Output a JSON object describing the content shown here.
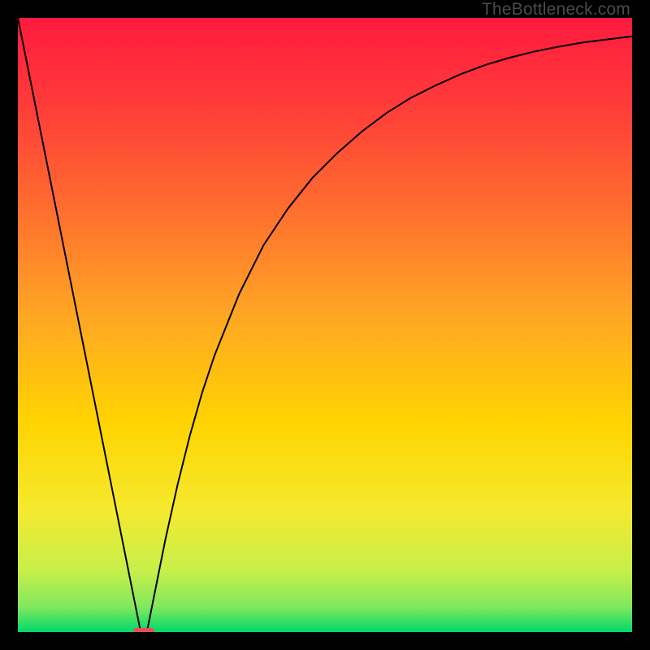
{
  "watermark": "TheBottleneck.com",
  "chart_data": {
    "type": "line",
    "title": "",
    "xlabel": "",
    "ylabel": "",
    "xlim": [
      0,
      100
    ],
    "ylim": [
      0,
      100
    ],
    "grid": false,
    "legend": false,
    "background_gradient": {
      "top_color": "#ff1a3f",
      "mid_color": "#ffd400",
      "bottom_color": "#00e060",
      "description": "vertical gradient red→orange→yellow→green"
    },
    "curve": {
      "description": "V-shaped curve with a sharp minimum near x≈20, left branch nearly linear to top-left corner, right branch concave rising toward top-right with decreasing slope",
      "color": "#000000",
      "x": [
        0,
        2,
        4,
        6,
        8,
        10,
        12,
        14,
        16,
        18,
        20,
        21,
        22,
        24,
        26,
        28,
        30,
        32,
        34,
        36,
        38,
        40,
        44,
        48,
        52,
        56,
        60,
        64,
        68,
        72,
        76,
        80,
        84,
        88,
        92,
        96,
        100
      ],
      "y": [
        100,
        90,
        80,
        70,
        60,
        50,
        40,
        30,
        20,
        10,
        0,
        0,
        5,
        15,
        24,
        32,
        39,
        45,
        50,
        55,
        59,
        63,
        69,
        74,
        78,
        81.5,
        84.5,
        87,
        89,
        90.8,
        92.3,
        93.5,
        94.5,
        95.3,
        96,
        96.5,
        97
      ]
    },
    "marker": {
      "description": "small red rounded capsule at curve minimum",
      "x": 20.5,
      "y": 0,
      "width_pct": 3.5,
      "height_pct": 1.4,
      "color": "#e74c5a"
    }
  }
}
